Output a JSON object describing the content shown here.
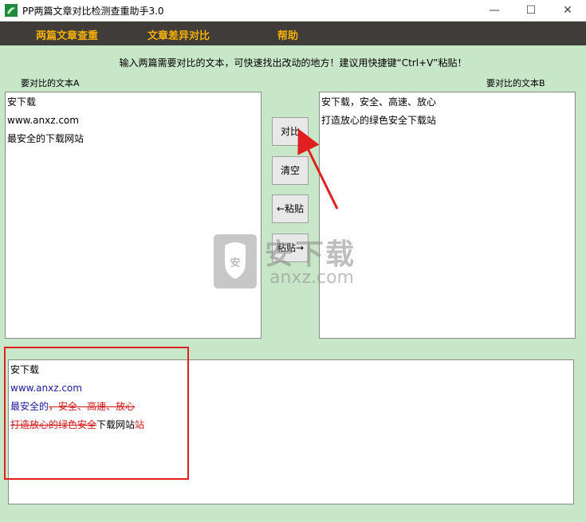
{
  "window": {
    "title": "PP两篇文章对比检测查重助手3.0",
    "minimize": "—",
    "maximize": "☐",
    "close": "✕"
  },
  "menu": {
    "items": [
      "两篇文章查重",
      "文章差异对比",
      "帮助"
    ]
  },
  "instruction": "输入两篇需要对比的文本，可快速找出改动的地方！建议用快捷键“Ctrl+V”粘贴！",
  "panel_a": {
    "label": "要对比的文本A",
    "lines": [
      "安下载",
      "www.anxz.com",
      "最安全的下载网站"
    ]
  },
  "panel_b": {
    "label": "要对比的文本B",
    "lines": [
      "安下载，安全、高速、放心",
      "打造放心的绿色安全下载站"
    ]
  },
  "buttons": {
    "compare": "对比",
    "clear": "清空",
    "paste_left": "←粘贴",
    "paste_right": "粘贴→"
  },
  "result": {
    "line1": "安下载",
    "line2": "www.anxz.com",
    "line3_plain": "最安全的",
    "line3_deleted": "，安全、高速、放心",
    "line4_deleted": "打造放心的绿色安全",
    "line4_plain": "下载网站",
    "line4_tail": "站"
  },
  "watermark": {
    "text": "安下载",
    "subtext": "anxz.com",
    "shield": "安"
  },
  "colors": {
    "background": "#c8e6c8",
    "menubar": "#403c3a",
    "menu_text": "#f5b000",
    "inserted": "#1a1a9c",
    "deleted": "#d01818",
    "annotation": "#e02020"
  }
}
